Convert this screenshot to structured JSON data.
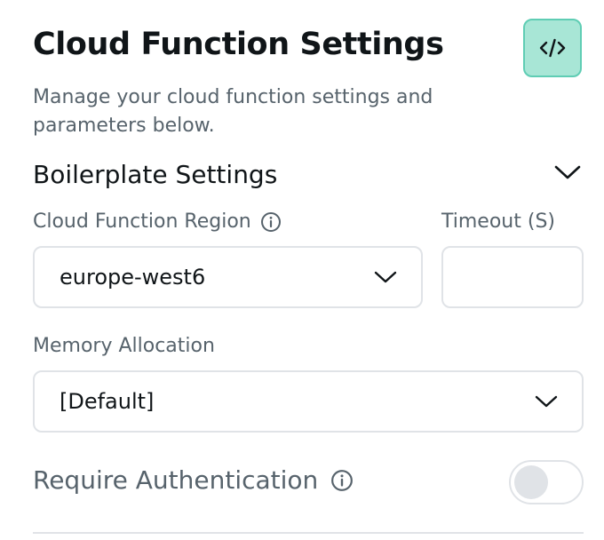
{
  "header": {
    "title": "Cloud Function Settings",
    "subtitle": "Manage your cloud function settings and parameters below.",
    "code_button_icon": "code-brackets-icon"
  },
  "boilerplate": {
    "section_title": "Boilerplate Settings",
    "expanded": true,
    "region": {
      "label": "Cloud Function Region",
      "value": "europe-west6"
    },
    "timeout": {
      "label": "Timeout (S)",
      "value": ""
    },
    "memory": {
      "label": "Memory Allocation",
      "value": "[Default]"
    },
    "require_auth": {
      "label": "Require Authentication",
      "enabled": false
    }
  },
  "colors": {
    "accent_fill": "#a8e6d6",
    "accent_border": "#5fcdb4",
    "primary_text": "#101518",
    "secondary_text": "#57636c",
    "border": "#e0e3e7"
  }
}
